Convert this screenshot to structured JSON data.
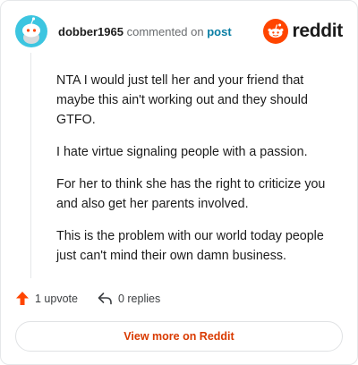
{
  "header": {
    "username": "dobber1965",
    "verb": "commented on",
    "link_label": "post",
    "brand_name": "reddit"
  },
  "comment": {
    "paragraphs": [
      "NTA I would just tell her and your friend that maybe this ain't working out and they should GTFO.",
      "I hate virtue signaling people with a passion.",
      "For her to think she has the right to criticize you and also get her parents involved.",
      "This is the problem with our world today people just can't mind their own damn business."
    ]
  },
  "actions": {
    "upvote_label": "1 upvote",
    "replies_label": "0 replies"
  },
  "footer": {
    "view_more_label": "View more on Reddit"
  },
  "colors": {
    "brand_orange": "#ff4500",
    "link_blue": "#0a7ea4",
    "avatar_bg": "#3cc5e0",
    "cta_text": "#d93a00"
  },
  "icons": {
    "avatar": "snoo-avatar",
    "brand": "reddit-logo-icon",
    "upvote": "upvote-arrow-icon",
    "reply": "reply-arrow-icon"
  }
}
